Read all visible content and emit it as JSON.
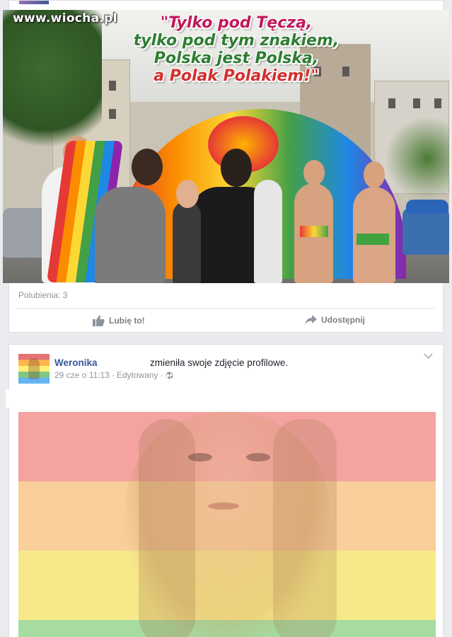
{
  "post1": {
    "watermark": "www.wiocha.pl",
    "slogan": {
      "line1": "\"Tylko pod Tęczą,",
      "line2": "tylko pod tym znakiem,",
      "line3": "Polska jest Polską,",
      "line4": "a Polak Polakiem!\""
    },
    "likes_label": "Polubienia: 3",
    "like_button": "Lubię to!",
    "share_button": "Udostępnij"
  },
  "post2": {
    "author": "Weronika",
    "action": "zmieniła swoje zdjęcie profilowe.",
    "meta_time": "29 cze o 11:13",
    "meta_edited": "Edytowany",
    "meta_sep": "·",
    "privacy_icon": "globe-icon"
  },
  "colors": {
    "link": "#365899",
    "muted": "#90949c",
    "bg": "#e9ebee",
    "rainbow_overlay": [
      "#f4a3a0",
      "#f8cf9a",
      "#f7e98a",
      "#a6dca0"
    ]
  }
}
